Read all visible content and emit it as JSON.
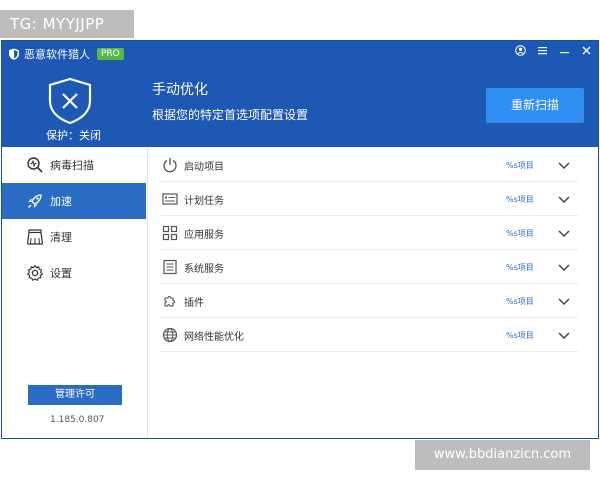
{
  "watermark_top": "TG: MYYJJPP",
  "watermark_bottom": "www.bbdianzicn.com",
  "window": {
    "title": "恶意软件猎人",
    "badge": "PRO",
    "controls": [
      "user-icon",
      "menu-icon",
      "minimize-icon",
      "close-icon"
    ]
  },
  "header": {
    "protect_status": "保护：关闭",
    "title": "手动优化",
    "subtitle": "根据您的特定首选项配置设置",
    "rescan_label": "重新扫描"
  },
  "sidebar": {
    "items": [
      {
        "label": "病毒扫描",
        "icon": "virus-scan-icon",
        "active": false
      },
      {
        "label": "加速",
        "icon": "rocket-icon",
        "active": true
      },
      {
        "label": "清理",
        "icon": "broom-icon",
        "active": false
      },
      {
        "label": "设置",
        "icon": "gear-icon",
        "active": false
      }
    ],
    "manage_label": "管理许可",
    "version": "1.185.0.807"
  },
  "rows": [
    {
      "label": "启动项目",
      "count": "%s项目",
      "icon": "power-icon"
    },
    {
      "label": "计划任务",
      "count": "%s项目",
      "icon": "task-list-icon"
    },
    {
      "label": "应用服务",
      "count": "%s项目",
      "icon": "grid-icon"
    },
    {
      "label": "系统服务",
      "count": "%s项目",
      "icon": "document-icon"
    },
    {
      "label": "插件",
      "count": "%s项目",
      "icon": "puzzle-icon"
    },
    {
      "label": "网络性能优化",
      "count": "%s项目",
      "icon": "globe-icon"
    }
  ],
  "colors": {
    "header_bg": "#1e58b5",
    "accent": "#2a6cc4",
    "button": "#2e8ef2",
    "badge": "#58b84a"
  }
}
